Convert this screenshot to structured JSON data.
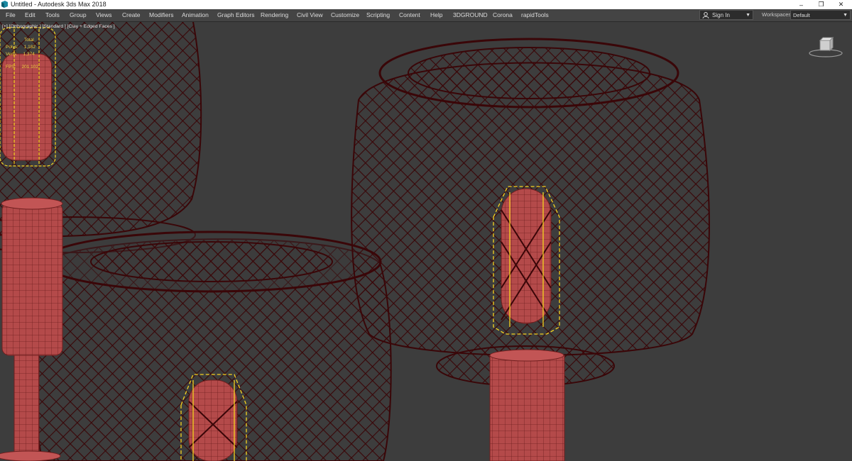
{
  "window": {
    "title": "Untitled - Autodesk 3ds Max 2018",
    "controls": {
      "minimize": "–",
      "restore": "❐",
      "close": "✕"
    }
  },
  "menu": {
    "items": [
      "File",
      "Edit",
      "Tools",
      "Group",
      "Views",
      "Create",
      "Modifiers",
      "Animation",
      "Graph Editors",
      "Rendering",
      "Civil View",
      "Customize",
      "Scripting",
      "Content",
      "Help",
      "3DGROUND",
      "Corona",
      "rapidTools"
    ]
  },
  "account": {
    "sign_in": "Sign In"
  },
  "workspaces": {
    "label": "Workspaces:",
    "value": "Default"
  },
  "viewport": {
    "label": "[+] [Orthographic ] [Standard ] [Clay + Edged Faces ]",
    "stats": {
      "header": "Total",
      "polys_label": "Polys:",
      "polys_value": "1,182",
      "verts_label": "Verts:",
      "verts_value": "1,374",
      "fps_label": "FPS:",
      "fps_value": "201.102"
    }
  },
  "colors": {
    "viewport_bg": "#3d3d3d",
    "menubar_bg": "#444444",
    "wire": "#3a0608",
    "clay": "#b44a4a",
    "selection": "#f5d320"
  }
}
